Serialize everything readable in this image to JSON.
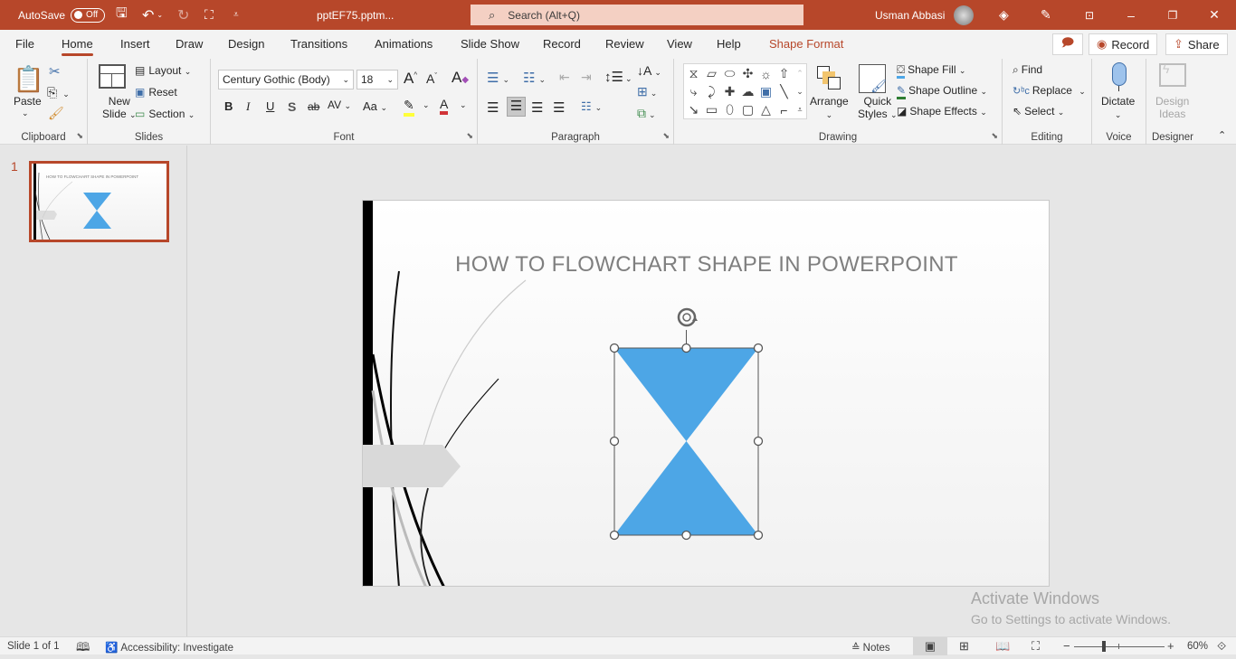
{
  "titlebar": {
    "autosave_label": "AutoSave",
    "autosave_state": "Off",
    "filename": "pptEF75.pptm...",
    "search_placeholder": "Search (Alt+Q)",
    "user_name": "Usman Abbasi",
    "icons": [
      "save-icon",
      "undo-icon",
      "redo-icon",
      "present-icon",
      "customize-qat-icon",
      "diamond-icon",
      "pen-icon",
      "ribbon-display-icon",
      "minimize-icon",
      "restore-icon",
      "close-icon"
    ]
  },
  "tabs": [
    {
      "label": "File"
    },
    {
      "label": "Home",
      "active": true
    },
    {
      "label": "Insert"
    },
    {
      "label": "Draw"
    },
    {
      "label": "Design"
    },
    {
      "label": "Transitions"
    },
    {
      "label": "Animations"
    },
    {
      "label": "Slide Show"
    },
    {
      "label": "Record"
    },
    {
      "label": "Review"
    },
    {
      "label": "View"
    },
    {
      "label": "Help"
    },
    {
      "label": "Shape Format",
      "contextual": true
    }
  ],
  "tab_actions": {
    "comments_icon": "comment-icon",
    "record_label": "Record",
    "share_label": "Share"
  },
  "ribbon": {
    "clipboard": {
      "label": "Clipboard",
      "paste": "Paste"
    },
    "slides": {
      "label": "Slides",
      "new_slide_1": "New",
      "new_slide_2": "Slide",
      "layout": "Layout",
      "reset": "Reset",
      "section": "Section"
    },
    "font": {
      "label": "Font",
      "font_name": "Century Gothic (Body)",
      "font_size": "18",
      "bold": "B",
      "italic": "I",
      "underline": "U",
      "shadow": "S",
      "strike": "ab",
      "spacing": "AV",
      "case": "Aa"
    },
    "paragraph": {
      "label": "Paragraph"
    },
    "drawing": {
      "label": "Drawing",
      "arrange": "Arrange",
      "quick_1": "Quick",
      "quick_2": "Styles",
      "shape_fill": "Shape Fill",
      "shape_outline": "Shape Outline",
      "shape_effects": "Shape Effects"
    },
    "editing": {
      "label": "Editing",
      "find": "Find",
      "replace": "Replace",
      "select": "Select"
    },
    "voice": {
      "label": "Voice",
      "dictate": "Dictate"
    },
    "designer": {
      "label": "Designer",
      "design_1": "Design",
      "design_2": "Ideas"
    }
  },
  "thumbnails": [
    {
      "number": "1",
      "title": "HOW TO FLOWCHART SHAPE IN POWERPOINT"
    }
  ],
  "slide": {
    "title": "HOW TO FLOWCHART SHAPE IN POWERPOINT",
    "shape_name": "Flowchart: Collate",
    "shape_fill": "#4da6e6"
  },
  "watermark": {
    "line1": "Activate Windows",
    "line2": "Go to Settings to activate Windows."
  },
  "status": {
    "slide_info": "Slide 1 of 1",
    "accessibility": "Accessibility: Investigate",
    "notes": "Notes",
    "zoom_level": "60%",
    "zoom_fraction": 0.33
  },
  "colors": {
    "accent": "#b7472a",
    "search_bg": "#f4d0c3"
  }
}
